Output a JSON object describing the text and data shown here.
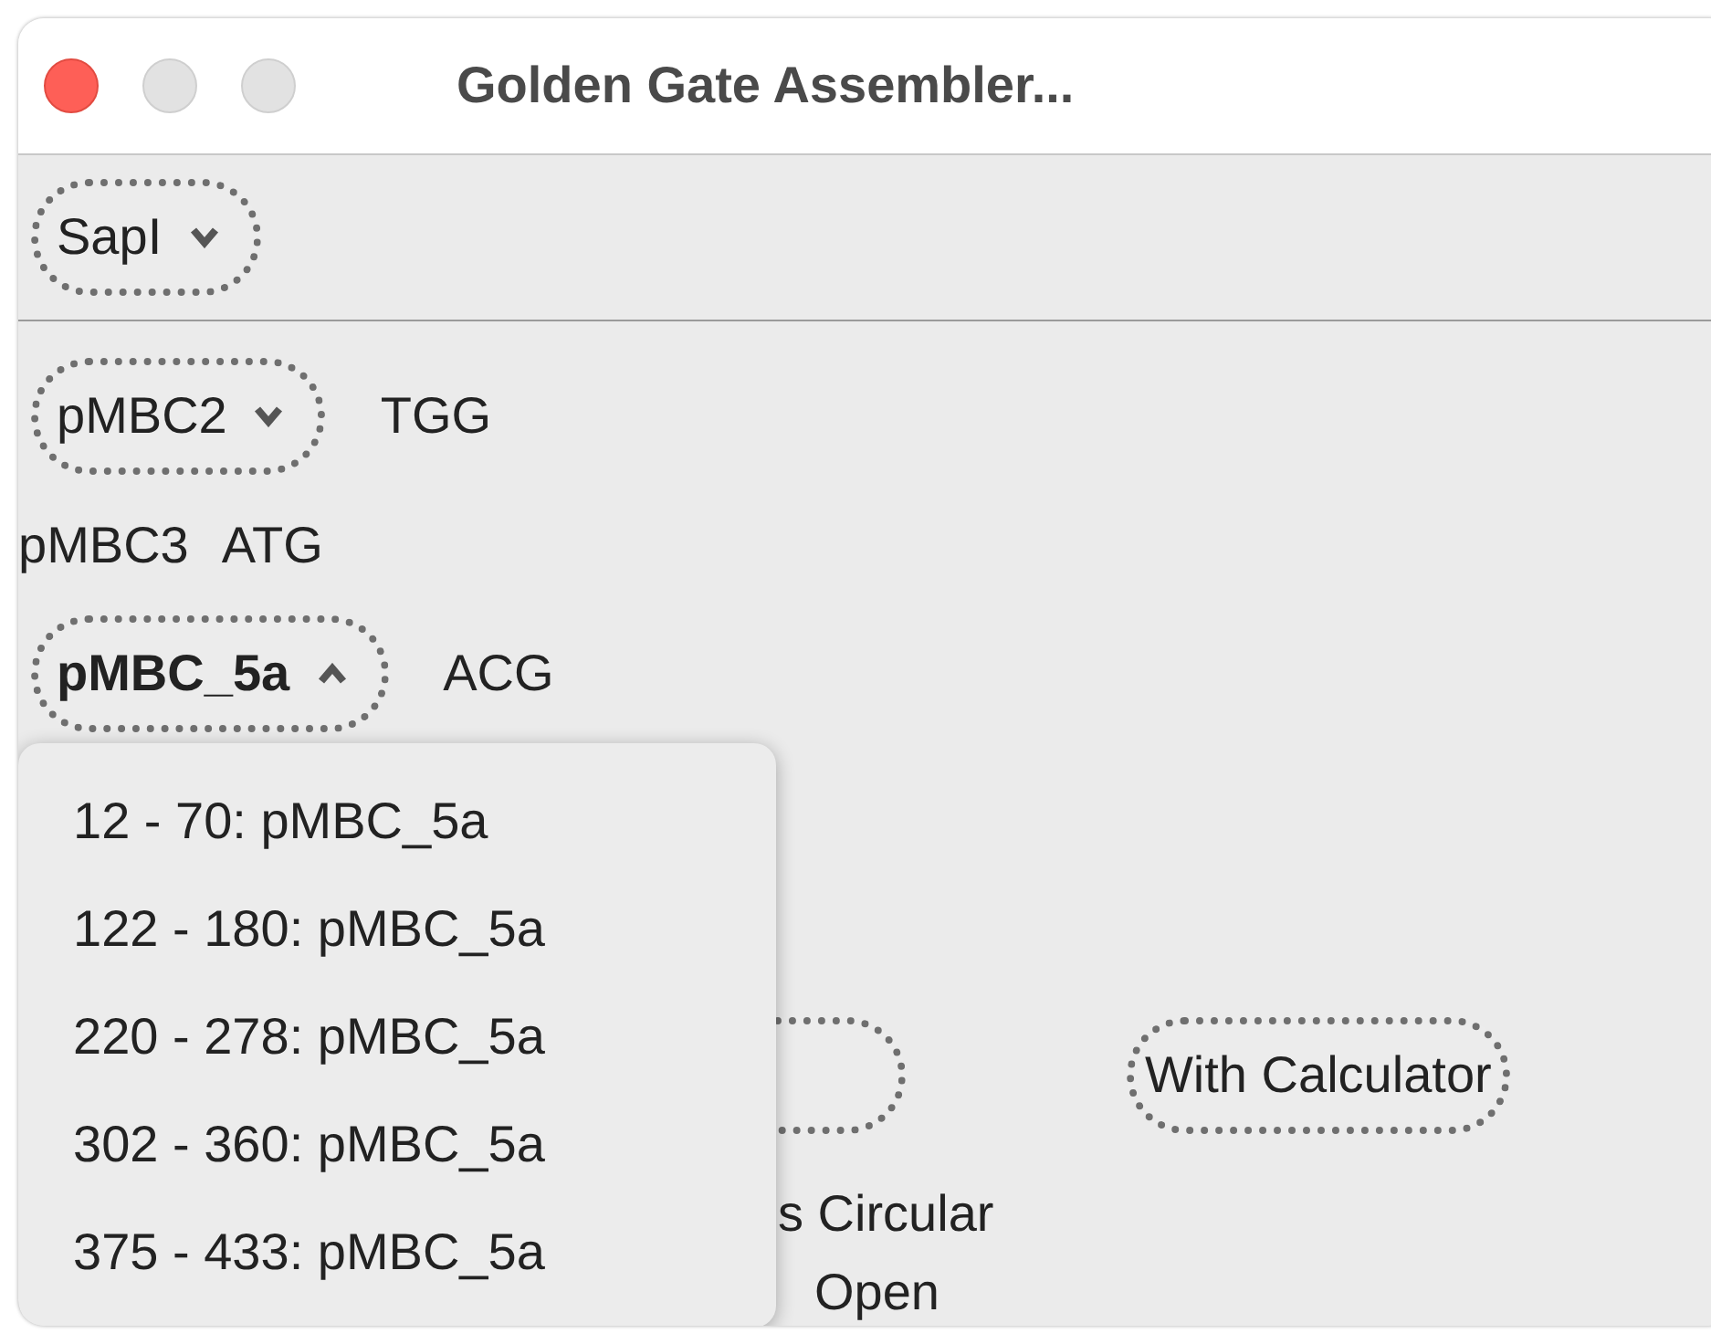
{
  "window": {
    "title": "Golden Gate Assembler..."
  },
  "enzyme_select": {
    "value": "SapI",
    "expanded": false
  },
  "parts": [
    {
      "kind": "select",
      "value": "pMBC2",
      "overhang": "TGG",
      "expanded": false
    },
    {
      "kind": "label",
      "value": "pMBC3",
      "overhang": "ATG"
    },
    {
      "kind": "select",
      "value": "pMBC_5a",
      "overhang": "ACG",
      "expanded": true
    }
  ],
  "menu": {
    "items": [
      {
        "label": "12 - 70: pMBC_5a"
      },
      {
        "label": "122 - 180: pMBC_5a"
      },
      {
        "label": "220 - 278: pMBC_5a"
      },
      {
        "label": "302 - 360: pMBC_5a"
      },
      {
        "label": "375 - 433: pMBC_5a"
      }
    ]
  },
  "buttons": [
    {
      "label": "With Calculator"
    }
  ],
  "options": [
    {
      "label": "s Circular"
    },
    {
      "label": "Open"
    }
  ]
}
